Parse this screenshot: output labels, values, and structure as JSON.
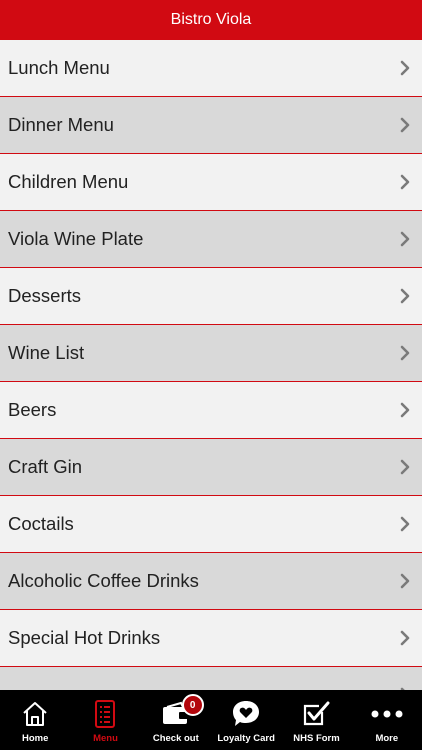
{
  "header": {
    "title": "Bistro Viola"
  },
  "menu": {
    "items": [
      {
        "label": "Lunch Menu"
      },
      {
        "label": "Dinner Menu"
      },
      {
        "label": "Children Menu"
      },
      {
        "label": "Viola Wine Plate"
      },
      {
        "label": "Desserts"
      },
      {
        "label": "Wine List"
      },
      {
        "label": "Beers"
      },
      {
        "label": "Craft Gin"
      },
      {
        "label": "Coctails"
      },
      {
        "label": "Alcoholic Coffee Drinks"
      },
      {
        "label": "Special Hot Drinks"
      },
      {
        "label": ""
      }
    ]
  },
  "tabbar": {
    "home": {
      "label": "Home",
      "icon": "home-icon"
    },
    "menu": {
      "label": "Menu",
      "icon": "menu-list-icon"
    },
    "checkout": {
      "label": "Check out",
      "icon": "wallet-icon",
      "badge": "0"
    },
    "loyalty": {
      "label": "Loyalty Card",
      "icon": "heart-bubble-icon"
    },
    "nhs": {
      "label": "NHS Form",
      "icon": "checkbox-icon"
    },
    "more": {
      "label": "More",
      "icon": "more-dots-icon"
    }
  },
  "colors": {
    "accent": "#d10a12",
    "row_light": "#f2f2f2",
    "row_dark": "#d9d9d9",
    "tabbar_bg": "#000000"
  }
}
